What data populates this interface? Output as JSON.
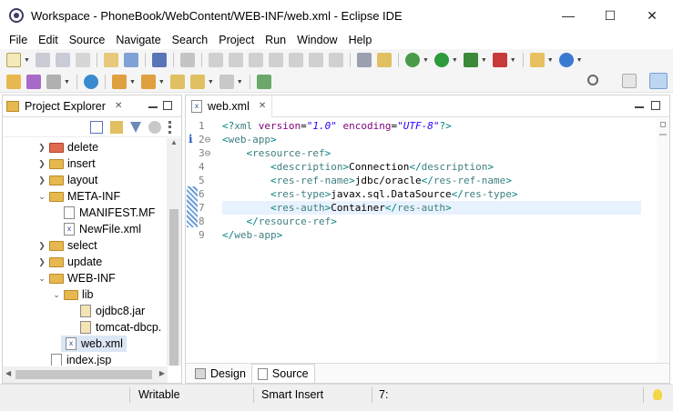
{
  "window": {
    "title": "Workspace - PhoneBook/WebContent/WEB-INF/web.xml - Eclipse IDE",
    "minimize": "—",
    "maximize": "☐",
    "close": "✕"
  },
  "menu": [
    "File",
    "Edit",
    "Source",
    "Navigate",
    "Search",
    "Project",
    "Run",
    "Window",
    "Help"
  ],
  "project_explorer": {
    "title": "Project Explorer",
    "close": "✕",
    "tree": [
      {
        "label": "delete",
        "type": "folder",
        "expanded": false,
        "depth": 0
      },
      {
        "label": "insert",
        "type": "folder",
        "expanded": false,
        "depth": 0
      },
      {
        "label": "layout",
        "type": "folder",
        "expanded": false,
        "depth": 0
      },
      {
        "label": "META-INF",
        "type": "folder",
        "expanded": true,
        "depth": 0
      },
      {
        "label": "MANIFEST.MF",
        "type": "file",
        "depth": 1
      },
      {
        "label": "NewFile.xml",
        "type": "xml",
        "depth": 1
      },
      {
        "label": "select",
        "type": "folder",
        "expanded": false,
        "depth": 0
      },
      {
        "label": "update",
        "type": "folder",
        "expanded": false,
        "depth": 0
      },
      {
        "label": "WEB-INF",
        "type": "folder",
        "expanded": true,
        "depth": 0
      },
      {
        "label": "lib",
        "type": "folder",
        "expanded": true,
        "depth": 1
      },
      {
        "label": "ojdbc8.jar",
        "type": "jar",
        "depth": 2
      },
      {
        "label": "tomcat-dbcp.",
        "type": "jar",
        "depth": 2
      },
      {
        "label": "web.xml",
        "type": "xml",
        "depth": 1,
        "selected": true
      },
      {
        "label": "index.jsp",
        "type": "file",
        "depth": 0
      }
    ]
  },
  "editor": {
    "tab_label": "web.xml",
    "tab_close": "✕",
    "line_numbers": [
      "1",
      "2⊖",
      "3⊖",
      "4",
      "5",
      "6",
      "7",
      "8",
      "9"
    ],
    "lines": [
      "<?xml version=\"1.0\" encoding=\"UTF-8\"?>",
      "<web-app>",
      "    <resource-ref>",
      "        <description>Connection</description>",
      "        <res-ref-name>jdbc/oracle</res-ref-name>",
      "        <res-type>javax.sql.DataSource</res-type>",
      "        <res-auth>Container</res-auth>",
      "    </resource-ref>",
      "</web-app>"
    ],
    "bottom_tabs": [
      "Design",
      "Source"
    ],
    "active_bottom_tab": "Source"
  },
  "status_bar": {
    "mode": "Writable",
    "insert_mode": "Smart Insert",
    "position": "7:"
  },
  "colors": {
    "tag": "#3f7f7f",
    "attribute": "#7f007f",
    "value": "#2a00ff",
    "current_line": "#e8f2fe",
    "selection": "#dbe6f5"
  }
}
